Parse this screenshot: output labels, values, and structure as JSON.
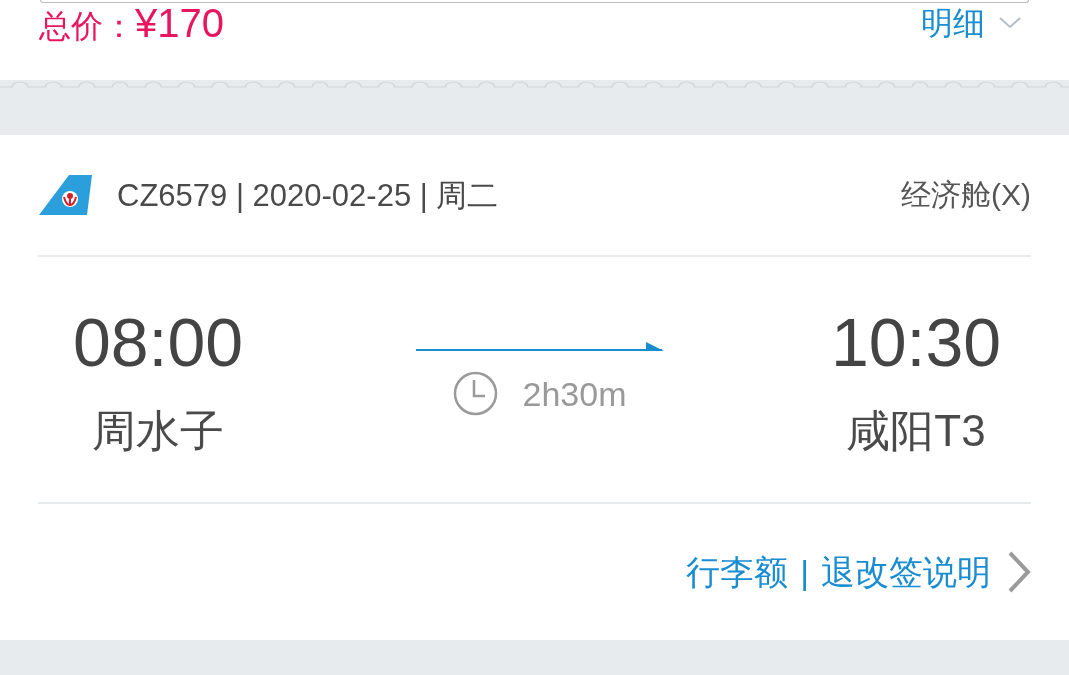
{
  "price_bar": {
    "label": "总价：",
    "amount": "¥170",
    "details": "明细"
  },
  "flight": {
    "summary": "CZ6579 | 2020-02-25 | 周二",
    "cabin": "经济舱(X)",
    "departure": {
      "time": "08:00",
      "airport": "周水子"
    },
    "duration": "2h30m",
    "arrival": {
      "time": "10:30",
      "airport": "咸阳T3"
    },
    "links": [
      "行李额",
      "退改签说明"
    ],
    "link_separator": "|"
  }
}
